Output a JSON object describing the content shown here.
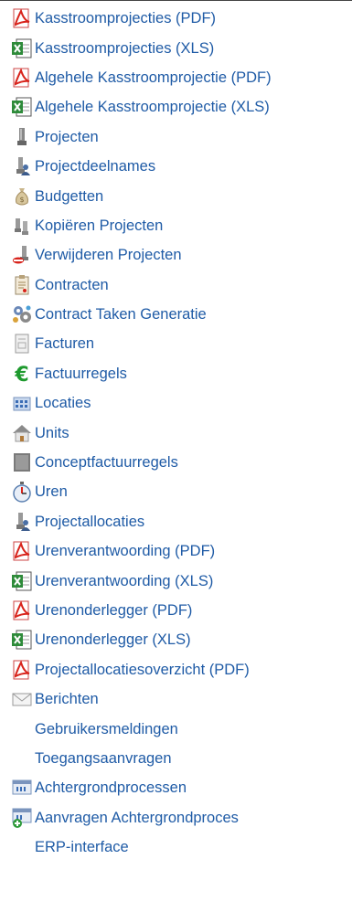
{
  "menu": {
    "items": [
      {
        "label": "Kasstroomprojecties (PDF)",
        "icon": "pdf-icon"
      },
      {
        "label": "Kasstroomprojecties (XLS)",
        "icon": "excel-icon"
      },
      {
        "label": "Algehele Kasstroomprojectie (PDF)",
        "icon": "pdf-icon"
      },
      {
        "label": "Algehele Kasstroomprojectie (XLS)",
        "icon": "excel-icon"
      },
      {
        "label": "Projecten",
        "icon": "project-icon"
      },
      {
        "label": "Projectdeelnames",
        "icon": "project-participation-icon"
      },
      {
        "label": "Budgetten",
        "icon": "money-bag-icon"
      },
      {
        "label": "Kopiëren Projecten",
        "icon": "copy-project-icon"
      },
      {
        "label": "Verwijderen Projecten",
        "icon": "delete-project-icon"
      },
      {
        "label": "Contracten",
        "icon": "contract-icon"
      },
      {
        "label": "Contract Taken Generatie",
        "icon": "gears-icon"
      },
      {
        "label": "Facturen",
        "icon": "invoice-icon"
      },
      {
        "label": "Factuurregels",
        "icon": "euro-icon"
      },
      {
        "label": "Locaties",
        "icon": "building-icon"
      },
      {
        "label": "Units",
        "icon": "house-icon"
      },
      {
        "label": "Conceptfactuurregels",
        "icon": "concept-invoice-icon"
      },
      {
        "label": "Uren",
        "icon": "stopwatch-icon"
      },
      {
        "label": "Projectallocaties",
        "icon": "project-allocation-icon"
      },
      {
        "label": "Urenverantwoording (PDF)",
        "icon": "pdf-icon"
      },
      {
        "label": "Urenverantwoording (XLS)",
        "icon": "excel-icon"
      },
      {
        "label": "Urenonderlegger (PDF)",
        "icon": "pdf-icon"
      },
      {
        "label": "Urenonderlegger (XLS)",
        "icon": "excel-icon"
      },
      {
        "label": "Projectallocatiesoverzicht (PDF)",
        "icon": "pdf-icon"
      },
      {
        "label": "Berichten",
        "icon": "envelope-icon"
      },
      {
        "label": "Gebruikersmeldingen",
        "icon": ""
      },
      {
        "label": "Toegangsaanvragen",
        "icon": ""
      },
      {
        "label": "Achtergrondprocessen",
        "icon": "background-process-icon"
      },
      {
        "label": "Aanvragen Achtergrondproces",
        "icon": "add-background-process-icon"
      },
      {
        "label": "ERP-interface",
        "icon": ""
      }
    ]
  },
  "colors": {
    "link": "#1f5ba6",
    "pdf": "#d8241c",
    "excel": "#2e8b3a",
    "euro": "#1e9a2e"
  }
}
